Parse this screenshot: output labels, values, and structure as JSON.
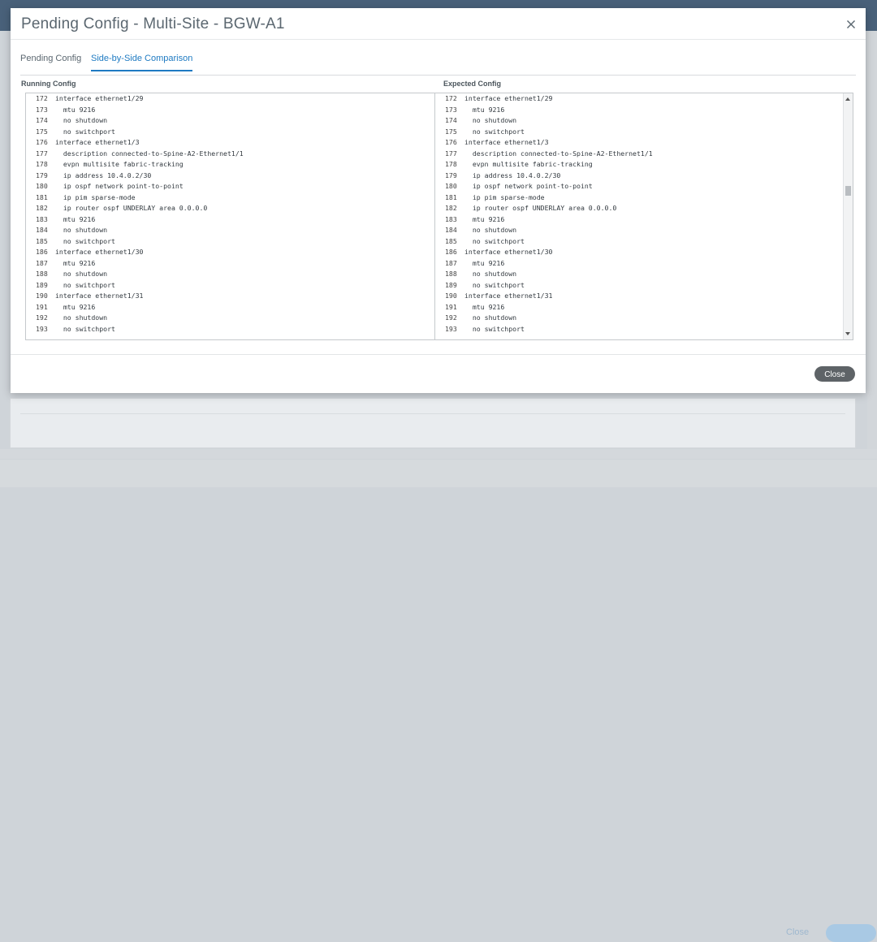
{
  "modal": {
    "title": "Pending Config - Multi-Site - BGW-A1",
    "tabs": [
      {
        "label": "Pending Config",
        "active": false
      },
      {
        "label": "Side-by-Side Comparison",
        "active": true
      }
    ],
    "left_label": "Running Config",
    "right_label": "Expected Config",
    "close_label": "Close",
    "accent_color": "#1e7ac2"
  },
  "running_config": [
    {
      "n": "172",
      "t": "interface ethernet1/29"
    },
    {
      "n": "173",
      "t": "  mtu 9216"
    },
    {
      "n": "174",
      "t": "  no shutdown"
    },
    {
      "n": "175",
      "t": "  no switchport"
    },
    {
      "n": "176",
      "t": "interface ethernet1/3"
    },
    {
      "n": "177",
      "t": "  description connected-to-Spine-A2-Ethernet1/1"
    },
    {
      "n": "178",
      "t": "  evpn multisite fabric-tracking"
    },
    {
      "n": "179",
      "t": "  ip address 10.4.0.2/30"
    },
    {
      "n": "180",
      "t": "  ip ospf network point-to-point"
    },
    {
      "n": "181",
      "t": "  ip pim sparse-mode"
    },
    {
      "n": "182",
      "t": "  ip router ospf UNDERLAY area 0.0.0.0"
    },
    {
      "n": "183",
      "t": "  mtu 9216"
    },
    {
      "n": "184",
      "t": "  no shutdown"
    },
    {
      "n": "185",
      "t": "  no switchport"
    },
    {
      "n": "186",
      "t": "interface ethernet1/30"
    },
    {
      "n": "187",
      "t": "  mtu 9216"
    },
    {
      "n": "188",
      "t": "  no shutdown"
    },
    {
      "n": "189",
      "t": "  no switchport"
    },
    {
      "n": "190",
      "t": "interface ethernet1/31"
    },
    {
      "n": "191",
      "t": "  mtu 9216"
    },
    {
      "n": "192",
      "t": "  no shutdown"
    },
    {
      "n": "193",
      "t": "  no switchport"
    }
  ],
  "expected_config": [
    {
      "n": "172",
      "t": "interface ethernet1/29"
    },
    {
      "n": "173",
      "t": "  mtu 9216"
    },
    {
      "n": "174",
      "t": "  no shutdown"
    },
    {
      "n": "175",
      "t": "  no switchport"
    },
    {
      "n": "176",
      "t": "interface ethernet1/3"
    },
    {
      "n": "177",
      "t": "  description connected-to-Spine-A2-Ethernet1/1"
    },
    {
      "n": "178",
      "t": "  evpn multisite fabric-tracking"
    },
    {
      "n": "179",
      "t": "  ip address 10.4.0.2/30"
    },
    {
      "n": "180",
      "t": "  ip ospf network point-to-point"
    },
    {
      "n": "181",
      "t": "  ip pim sparse-mode"
    },
    {
      "n": "182",
      "t": "  ip router ospf UNDERLAY area 0.0.0.0"
    },
    {
      "n": "183",
      "t": "  mtu 9216"
    },
    {
      "n": "184",
      "t": "  no shutdown"
    },
    {
      "n": "185",
      "t": "  no switchport"
    },
    {
      "n": "186",
      "t": "interface ethernet1/30"
    },
    {
      "n": "187",
      "t": "  mtu 9216"
    },
    {
      "n": "188",
      "t": "  no shutdown"
    },
    {
      "n": "189",
      "t": "  no switchport"
    },
    {
      "n": "190",
      "t": "interface ethernet1/31"
    },
    {
      "n": "191",
      "t": "  mtu 9216"
    },
    {
      "n": "192",
      "t": "  no shutdown"
    },
    {
      "n": "193",
      "t": "  no switchport"
    }
  ],
  "background": {
    "footer_close_label": "Close"
  }
}
